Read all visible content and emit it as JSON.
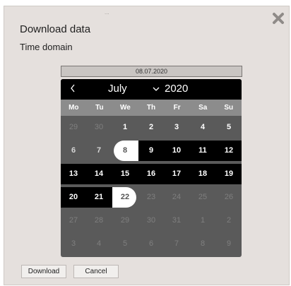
{
  "dialog": {
    "top_mark": "...",
    "title": "Download data",
    "subtitle": "Time domain"
  },
  "date_input": {
    "value": "08.07.2020"
  },
  "calendar": {
    "month": "July",
    "year": "2020",
    "weekdays": [
      "Mo",
      "Tu",
      "We",
      "Th",
      "Fr",
      "Sa",
      "Su"
    ],
    "weeks": [
      [
        "29",
        "30",
        "1",
        "2",
        "3",
        "4",
        "5"
      ],
      [
        "6",
        "7",
        "8",
        "9",
        "10",
        "11",
        "12"
      ],
      [
        "13",
        "14",
        "15",
        "16",
        "17",
        "18",
        "19"
      ],
      [
        "20",
        "21",
        "22",
        "23",
        "24",
        "25",
        "26"
      ],
      [
        "27",
        "28",
        "29",
        "30",
        "31",
        "1",
        "2"
      ],
      [
        "3",
        "4",
        "5",
        "6",
        "7",
        "8",
        "9"
      ]
    ],
    "range_start": "8",
    "range_end": "22"
  },
  "buttons": {
    "download": "Download",
    "cancel": "Cancel"
  },
  "colors": {
    "dialog_bg": "#e5e0dd",
    "calendar_header": "#000000",
    "weekday_bar": "#8c8c8c",
    "calendar_body": "#5a5a5a",
    "range_edge": "#ffffff"
  },
  "icons": {
    "close": "close-icon",
    "prev_month": "chevron-left-icon",
    "month_dropdown": "chevron-down-icon"
  }
}
